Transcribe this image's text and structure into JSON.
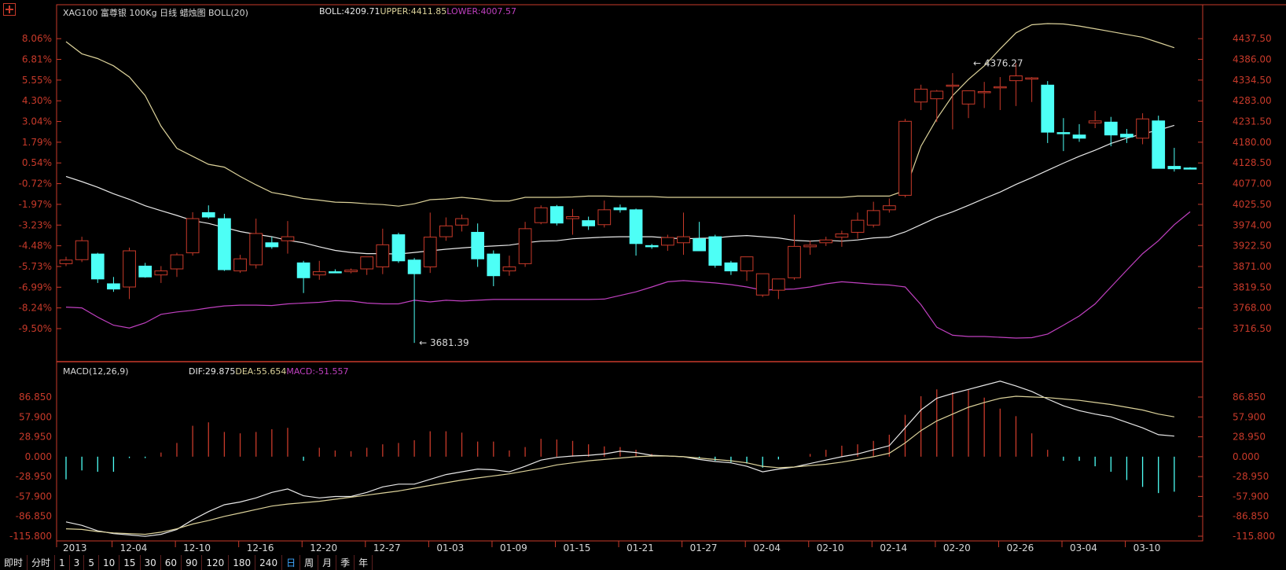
{
  "header": {
    "title": "XAG100 富尊银 100Kg 日线  蜡烛图 BOLL(20)",
    "boll_label": "BOLL:4209.71",
    "upper_label": "UPPER:4411.85",
    "lower_label": "LOWER:4007.57",
    "macd_title": "MACD(12,26,9)",
    "dif_label": "DIF:29.875",
    "dea_label": "DEA:55.654",
    "macd_label": "MACD:-51.557"
  },
  "colors": {
    "up": "#c83a2a",
    "down": "#4dfff6",
    "mid": "#e8e8e8",
    "upper": "#dcd29a",
    "lower": "#c040c0",
    "axis": "#c83a2a",
    "dif": "#e8e8e8",
    "dea": "#dcd29a"
  },
  "tabs": [
    "即时",
    "分时",
    "1",
    "3",
    "5",
    "10",
    "15",
    "30",
    "60",
    "90",
    "120",
    "180",
    "240",
    "日",
    "周",
    "月",
    "季",
    "年"
  ],
  "active_tab": "日",
  "chart_data": [
    {
      "type": "candlestick",
      "title": "XAG100 富尊银 100Kg 日线",
      "x_ticks": [
        "2013",
        "12-04",
        "12-10",
        "12-16",
        "12-20",
        "12-27",
        "01-03",
        "01-09",
        "01-15",
        "01-21",
        "01-27",
        "02-04",
        "02-10",
        "02-14",
        "02-20",
        "02-26",
        "03-04",
        "03-10"
      ],
      "y_ticks_right": [
        "4437.50",
        "4386.00",
        "4334.50",
        "4283.00",
        "4231.50",
        "4180.00",
        "4128.50",
        "4077.00",
        "4025.50",
        "3974.00",
        "3922.50",
        "3871.00",
        "3819.50",
        "3768.00",
        "3716.50"
      ],
      "y_ticks_left": [
        "8.06%",
        "6.81%",
        "5.55%",
        "4.30%",
        "3.04%",
        "1.79%",
        "0.54%",
        "-0.72%",
        "-1.97%",
        "-3.23%",
        "-4.48%",
        "-5.73%",
        "-6.99%",
        "-8.24%",
        "-9.50%"
      ],
      "ylim": [
        3650,
        4475
      ],
      "annotations": [
        {
          "text": "4376.27",
          "value": 4376.27,
          "index": 57
        },
        {
          "text": "3681.39",
          "value": 3681.39,
          "index": 22
        }
      ],
      "candles": [
        {
          "o": 3878,
          "h": 3895,
          "l": 3872,
          "c": 3887
        },
        {
          "o": 3888,
          "h": 3945,
          "l": 3882,
          "c": 3935
        },
        {
          "o": 3902,
          "h": 3905,
          "l": 3830,
          "c": 3840
        },
        {
          "o": 3828,
          "h": 3845,
          "l": 3808,
          "c": 3815
        },
        {
          "o": 3820,
          "h": 3918,
          "l": 3790,
          "c": 3910
        },
        {
          "o": 3872,
          "h": 3880,
          "l": 3843,
          "c": 3845
        },
        {
          "o": 3850,
          "h": 3872,
          "l": 3830,
          "c": 3860
        },
        {
          "o": 3865,
          "h": 3905,
          "l": 3845,
          "c": 3900
        },
        {
          "o": 3905,
          "h": 4006,
          "l": 3898,
          "c": 3990
        },
        {
          "o": 4005,
          "h": 4023,
          "l": 3990,
          "c": 3994
        },
        {
          "o": 3990,
          "h": 4002,
          "l": 3860,
          "c": 3863
        },
        {
          "o": 3860,
          "h": 3900,
          "l": 3855,
          "c": 3890
        },
        {
          "o": 3875,
          "h": 3990,
          "l": 3866,
          "c": 3953
        },
        {
          "o": 3930,
          "h": 3945,
          "l": 3915,
          "c": 3920
        },
        {
          "o": 3935,
          "h": 3984,
          "l": 3903,
          "c": 3945
        },
        {
          "o": 3880,
          "h": 3885,
          "l": 3805,
          "c": 3843
        },
        {
          "o": 3850,
          "h": 3885,
          "l": 3838,
          "c": 3858
        },
        {
          "o": 3858,
          "h": 3864,
          "l": 3855,
          "c": 3856
        },
        {
          "o": 3858,
          "h": 3866,
          "l": 3854,
          "c": 3862
        },
        {
          "o": 3865,
          "h": 3890,
          "l": 3850,
          "c": 3895
        },
        {
          "o": 3870,
          "h": 3965,
          "l": 3852,
          "c": 3925
        },
        {
          "o": 3950,
          "h": 3955,
          "l": 3880,
          "c": 3885
        },
        {
          "o": 3887,
          "h": 3892,
          "l": 3681,
          "c": 3853
        },
        {
          "o": 3870,
          "h": 4005,
          "l": 3855,
          "c": 3944
        },
        {
          "o": 3945,
          "h": 3993,
          "l": 3935,
          "c": 3972
        },
        {
          "o": 3974,
          "h": 4000,
          "l": 3958,
          "c": 3990
        },
        {
          "o": 3956,
          "h": 3978,
          "l": 3870,
          "c": 3890
        },
        {
          "o": 3902,
          "h": 3911,
          "l": 3822,
          "c": 3848
        },
        {
          "o": 3860,
          "h": 3898,
          "l": 3848,
          "c": 3870
        },
        {
          "o": 3878,
          "h": 3982,
          "l": 3870,
          "c": 3965
        },
        {
          "o": 3980,
          "h": 4023,
          "l": 3976,
          "c": 4017
        },
        {
          "o": 4020,
          "h": 4024,
          "l": 3973,
          "c": 3979
        },
        {
          "o": 3990,
          "h": 4014,
          "l": 3950,
          "c": 3995
        },
        {
          "o": 3985,
          "h": 3995,
          "l": 3962,
          "c": 3972
        },
        {
          "o": 3975,
          "h": 4035,
          "l": 3968,
          "c": 4012
        },
        {
          "o": 4017,
          "h": 4025,
          "l": 4005,
          "c": 4012
        },
        {
          "o": 4012,
          "h": 4015,
          "l": 3898,
          "c": 3928
        },
        {
          "o": 3923,
          "h": 3927,
          "l": 3915,
          "c": 3920
        },
        {
          "o": 3924,
          "h": 3950,
          "l": 3910,
          "c": 3943
        },
        {
          "o": 3930,
          "h": 4005,
          "l": 3900,
          "c": 3945
        },
        {
          "o": 3940,
          "h": 3982,
          "l": 3920,
          "c": 3910
        },
        {
          "o": 3945,
          "h": 3950,
          "l": 3868,
          "c": 3874
        },
        {
          "o": 3880,
          "h": 3885,
          "l": 3850,
          "c": 3860
        },
        {
          "o": 3860,
          "h": 3895,
          "l": 3835,
          "c": 3895
        },
        {
          "o": 3800,
          "h": 3852,
          "l": 3795,
          "c": 3853
        },
        {
          "o": 3812,
          "h": 3823,
          "l": 3790,
          "c": 3840
        },
        {
          "o": 3843,
          "h": 4000,
          "l": 3838,
          "c": 3921
        },
        {
          "o": 3920,
          "h": 3935,
          "l": 3900,
          "c": 3924
        },
        {
          "o": 3930,
          "h": 3945,
          "l": 3922,
          "c": 3937
        },
        {
          "o": 3944,
          "h": 3960,
          "l": 3920,
          "c": 3952
        },
        {
          "o": 3956,
          "h": 4005,
          "l": 3940,
          "c": 3986
        },
        {
          "o": 3974,
          "h": 4032,
          "l": 3968,
          "c": 4010
        },
        {
          "o": 4012,
          "h": 4040,
          "l": 4005,
          "c": 4022
        },
        {
          "o": 4048,
          "h": 4238,
          "l": 4043,
          "c": 4232
        },
        {
          "o": 4280,
          "h": 4323,
          "l": 4260,
          "c": 4312
        },
        {
          "o": 4288,
          "h": 4310,
          "l": 4230,
          "c": 4307
        },
        {
          "o": 4320,
          "h": 4352,
          "l": 4212,
          "c": 4322
        },
        {
          "o": 4275,
          "h": 4300,
          "l": 4240,
          "c": 4308
        },
        {
          "o": 4306,
          "h": 4330,
          "l": 4265,
          "c": 4306
        },
        {
          "o": 4318,
          "h": 4342,
          "l": 4260,
          "c": 4318
        },
        {
          "o": 4333,
          "h": 4376,
          "l": 4270,
          "c": 4345
        },
        {
          "o": 4337,
          "h": 4342,
          "l": 4280,
          "c": 4340
        },
        {
          "o": 4322,
          "h": 4332,
          "l": 4178,
          "c": 4205
        },
        {
          "o": 4204,
          "h": 4240,
          "l": 4158,
          "c": 4203
        },
        {
          "o": 4198,
          "h": 4225,
          "l": 4181,
          "c": 4190
        },
        {
          "o": 4228,
          "h": 4258,
          "l": 4215,
          "c": 4233
        },
        {
          "o": 4230,
          "h": 4243,
          "l": 4170,
          "c": 4198
        },
        {
          "o": 4200,
          "h": 4213,
          "l": 4178,
          "c": 4193
        },
        {
          "o": 4190,
          "h": 4252,
          "l": 4175,
          "c": 4238
        },
        {
          "o": 4233,
          "h": 4246,
          "l": 4140,
          "c": 4115
        },
        {
          "o": 4120,
          "h": 4166,
          "l": 4107,
          "c": 4114
        },
        {
          "o": 4116,
          "h": 4118,
          "l": 4113,
          "c": 4114
        }
      ],
      "boll_mid": [
        4095,
        4082,
        4068,
        4052,
        4038,
        4022,
        4010,
        3998,
        3985,
        3978,
        3968,
        3958,
        3951,
        3945,
        3936,
        3930,
        3920,
        3911,
        3906,
        3903,
        3903,
        3902,
        3906,
        3910,
        3914,
        3917,
        3920,
        3922,
        3924,
        3930,
        3934,
        3935,
        3940,
        3942,
        3944,
        3945,
        3945,
        3945,
        3942,
        3940,
        3941,
        3942,
        3946,
        3948,
        3945,
        3942,
        3936,
        3934,
        3936,
        3934,
        3937,
        3942,
        3944,
        3957,
        3975,
        3993,
        4007,
        4023,
        4040,
        4056,
        4075,
        4092,
        4110,
        4128,
        4145,
        4160,
        4177,
        4190,
        4201,
        4210,
        4222
      ],
      "boll_upper": [
        4430,
        4400,
        4388,
        4370,
        4342,
        4296,
        4220,
        4165,
        4145,
        4125,
        4118,
        4095,
        4074,
        4055,
        4048,
        4040,
        4036,
        4031,
        4030,
        4027,
        4025,
        4021,
        4027,
        4037,
        4039,
        4043,
        4039,
        4034,
        4034,
        4043,
        4043,
        4043,
        4044,
        4046,
        4046,
        4045,
        4045,
        4045,
        4043,
        4043,
        4043,
        4043,
        4043,
        4043,
        4043,
        4043,
        4043,
        4043,
        4043,
        4043,
        4046,
        4046,
        4046,
        4060,
        4170,
        4238,
        4296,
        4336,
        4370,
        4412,
        4452,
        4472,
        4475,
        4474,
        4469,
        4462,
        4455,
        4448,
        4441,
        4428,
        4415
      ],
      "boll_lower": [
        3770,
        3768,
        3745,
        3725,
        3718,
        3731,
        3752,
        3758,
        3762,
        3768,
        3773,
        3775,
        3775,
        3774,
        3778,
        3780,
        3782,
        3786,
        3785,
        3780,
        3778,
        3778,
        3787,
        3783,
        3787,
        3785,
        3787,
        3789,
        3789,
        3789,
        3789,
        3789,
        3789,
        3789,
        3790,
        3799,
        3808,
        3820,
        3833,
        3836,
        3833,
        3830,
        3826,
        3820,
        3812,
        3814,
        3815,
        3820,
        3828,
        3833,
        3830,
        3827,
        3825,
        3820,
        3776,
        3720,
        3700,
        3697,
        3697,
        3695,
        3693,
        3694,
        3703,
        3725,
        3748,
        3778,
        3820,
        3862,
        3903,
        3935,
        3975,
        4007
      ],
      "price_y_range": [
        3650,
        4475
      ]
    },
    {
      "type": "bar",
      "title": "MACD(12,26,9)",
      "y_ticks_left": [
        "86.850",
        "57.900",
        "28.950",
        "0.000",
        "-28.950",
        "-57.900",
        "-86.850",
        "-115.800"
      ],
      "y_ticks_right": [
        "86.850",
        "57.900",
        "28.950",
        "0.000",
        "-28.950",
        "-57.900",
        "-86.850",
        "-115.800"
      ],
      "ylim": [
        -115.8,
        112
      ],
      "dif": [
        -95,
        -100,
        -108,
        -112,
        -114,
        -116,
        -113,
        -106,
        -92,
        -80,
        -70,
        -66,
        -60,
        -52,
        -47,
        -57,
        -60,
        -58,
        -58,
        -52,
        -44,
        -40,
        -40,
        -33,
        -26,
        -22,
        -18,
        -19,
        -22,
        -14,
        -5,
        -1,
        1,
        2,
        4,
        8,
        6,
        2,
        1,
        0,
        -4,
        -7,
        -9,
        -14,
        -22,
        -18,
        -15,
        -10,
        -5,
        0,
        4,
        10,
        16,
        42,
        68,
        85,
        92,
        98,
        104,
        110,
        103,
        95,
        84,
        74,
        67,
        62,
        58,
        50,
        42,
        32,
        30
      ],
      "dea": [
        -105,
        -106,
        -109,
        -111,
        -112,
        -113,
        -110,
        -105,
        -98,
        -93,
        -87,
        -82,
        -77,
        -72,
        -69,
        -67,
        -65,
        -62,
        -59,
        -56,
        -53,
        -50,
        -46,
        -42,
        -38,
        -34,
        -31,
        -28,
        -25,
        -21,
        -17,
        -12,
        -9,
        -6,
        -4,
        -2,
        0,
        1,
        1,
        0,
        -2,
        -4,
        -6,
        -9,
        -14,
        -16,
        -15,
        -13,
        -11,
        -8,
        -4,
        0,
        5,
        20,
        38,
        52,
        62,
        72,
        79,
        85,
        88,
        87,
        86,
        84,
        82,
        79,
        76,
        72,
        68,
        62,
        58
      ],
      "macd": [
        -33,
        -20,
        -22,
        -22,
        -2,
        -2,
        6,
        20,
        45,
        50,
        36,
        34,
        36,
        40,
        42,
        -6,
        13,
        9,
        8,
        13,
        18,
        20,
        24,
        37,
        37,
        35,
        22,
        22,
        9,
        14,
        26,
        25,
        23,
        18,
        15,
        14,
        10,
        4,
        0,
        0,
        -2,
        -6,
        -8,
        -10,
        -16,
        -4,
        0,
        4,
        10,
        16,
        18,
        23,
        32,
        61,
        88,
        98,
        94,
        97,
        86,
        70,
        59,
        34,
        10,
        -6,
        -6,
        -14,
        -22,
        -34,
        -44,
        -53,
        -51
      ]
    }
  ]
}
